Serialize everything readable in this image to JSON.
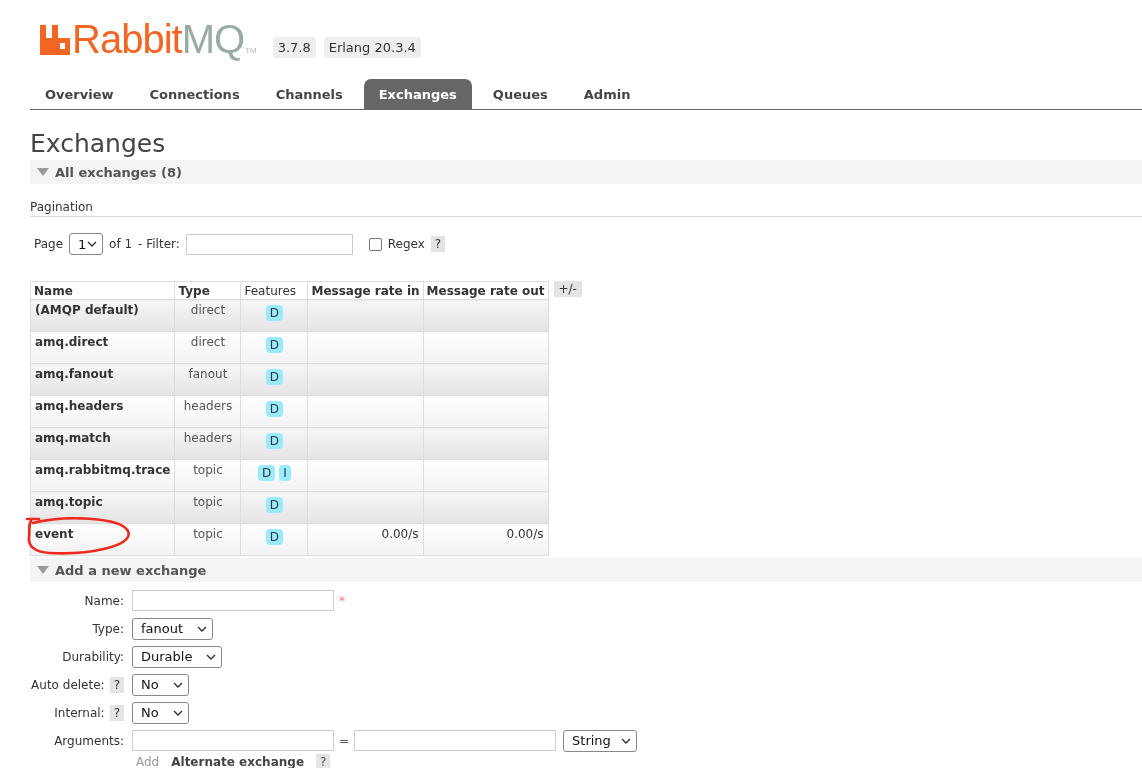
{
  "logo": {
    "word_1": "Rabbit",
    "word_2": "MQ",
    "trademark": "TM"
  },
  "version_badges": [
    "3.7.8",
    "Erlang 20.3.4"
  ],
  "tabs": [
    {
      "label": "Overview",
      "selected": false
    },
    {
      "label": "Connections",
      "selected": false
    },
    {
      "label": "Channels",
      "selected": false
    },
    {
      "label": "Exchanges",
      "selected": true
    },
    {
      "label": "Queues",
      "selected": false
    },
    {
      "label": "Admin",
      "selected": false
    }
  ],
  "page_title": "Exchanges",
  "list_section": {
    "title": "All exchanges (8)",
    "expanded": true
  },
  "pagination": {
    "heading": "Pagination",
    "page_label": "Page",
    "page_value": "1",
    "of_label": "of 1",
    "filter_label": "- Filter:",
    "regex_label": "Regex",
    "regex_checked": false,
    "help": "?"
  },
  "table": {
    "columns": [
      {
        "label": "Name",
        "bold": true
      },
      {
        "label": "Type",
        "bold": true
      },
      {
        "label": "Features",
        "bold": false
      },
      {
        "label": "Message rate in",
        "bold": true
      },
      {
        "label": "Message rate out",
        "bold": true
      }
    ],
    "toggle_columns": "+/-",
    "rows": [
      {
        "name": "(AMQP default)",
        "type": "direct",
        "features": [
          "D"
        ],
        "rate_in": "",
        "rate_out": "",
        "annotated": false
      },
      {
        "name": "amq.direct",
        "type": "direct",
        "features": [
          "D"
        ],
        "rate_in": "",
        "rate_out": "",
        "annotated": false
      },
      {
        "name": "amq.fanout",
        "type": "fanout",
        "features": [
          "D"
        ],
        "rate_in": "",
        "rate_out": "",
        "annotated": false
      },
      {
        "name": "amq.headers",
        "type": "headers",
        "features": [
          "D"
        ],
        "rate_in": "",
        "rate_out": "",
        "annotated": false
      },
      {
        "name": "amq.match",
        "type": "headers",
        "features": [
          "D"
        ],
        "rate_in": "",
        "rate_out": "",
        "annotated": false
      },
      {
        "name": "amq.rabbitmq.trace",
        "type": "topic",
        "features": [
          "D",
          "I"
        ],
        "rate_in": "",
        "rate_out": "",
        "annotated": false
      },
      {
        "name": "amq.topic",
        "type": "topic",
        "features": [
          "D"
        ],
        "rate_in": "",
        "rate_out": "",
        "annotated": false
      },
      {
        "name": "event",
        "type": "topic",
        "features": [
          "D"
        ],
        "rate_in": "0.00/s",
        "rate_out": "0.00/s",
        "annotated": true
      }
    ]
  },
  "add_section": {
    "title": "Add a new exchange",
    "expanded": true
  },
  "form": [
    {
      "kind": "text",
      "label": "Name:",
      "required_mark": "*"
    },
    {
      "kind": "select",
      "label": "Type:",
      "value": "fanout"
    },
    {
      "kind": "select",
      "label": "Durability:",
      "value": "Durable"
    },
    {
      "kind": "select",
      "label": "Auto delete:",
      "help": "?",
      "value": "No"
    },
    {
      "kind": "select",
      "label": "Internal:",
      "help": "?",
      "value": "No"
    },
    {
      "kind": "arguments",
      "label": "Arguments:",
      "equals": "=",
      "value": "String"
    }
  ],
  "add_link": "Add",
  "alternate_exchange": {
    "label": "Alternate exchange",
    "help": "?"
  }
}
